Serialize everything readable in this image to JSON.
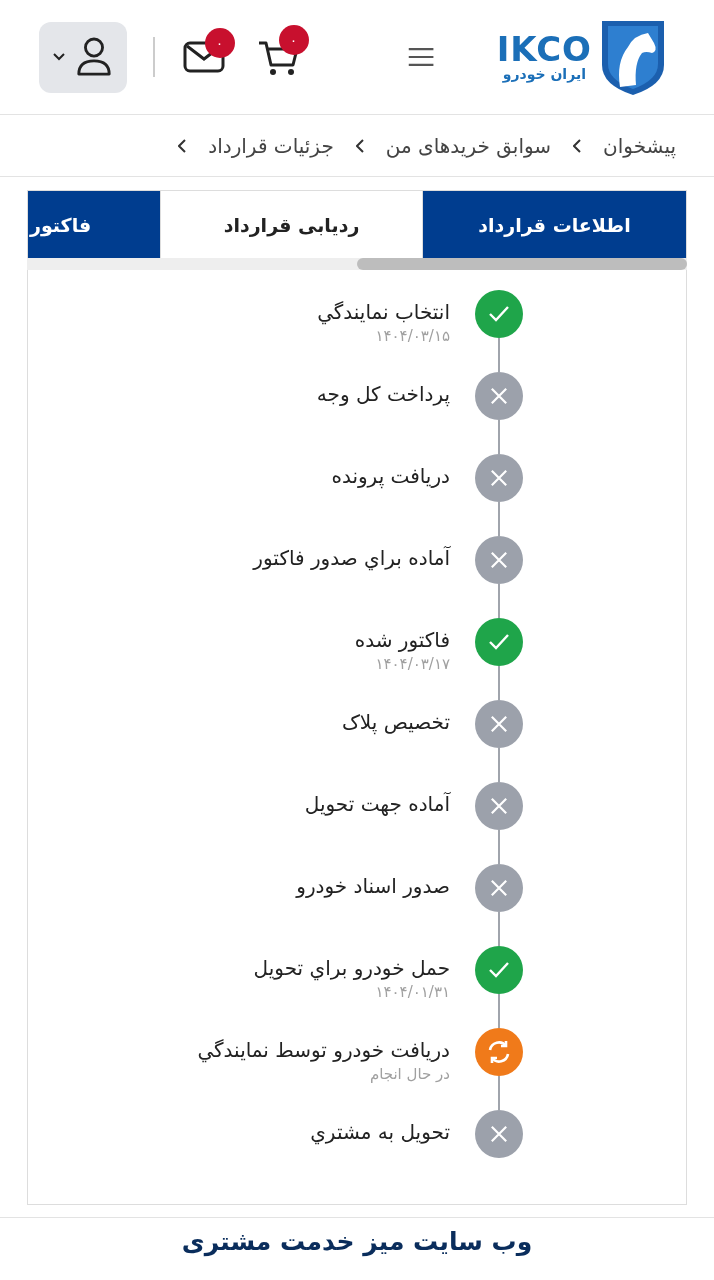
{
  "header": {
    "logo": {
      "latin": "IKCO",
      "persian": "ایران خودرو"
    },
    "cart_badge": "۰",
    "mail_badge": "۰"
  },
  "breadcrumb": [
    "پیشخوان",
    "سوابق خریدهای من",
    "جزئیات قرارداد"
  ],
  "tabs": [
    {
      "label": "اطلاعات قرارداد",
      "selected": false
    },
    {
      "label": "ردیابی قرارداد",
      "selected": true
    },
    {
      "label": "فاکتور",
      "selected": false
    }
  ],
  "steps": [
    {
      "title": "انتخاب نمايندگي",
      "kind": "done",
      "note": "۱۴۰۴/۰۳/۱۵"
    },
    {
      "title": "پرداخت کل وجه",
      "kind": "pending"
    },
    {
      "title": "دریافت پرونده",
      "kind": "pending"
    },
    {
      "title": "آماده براي صدور فاکتور",
      "kind": "pending"
    },
    {
      "title": "فاکتور شده",
      "kind": "done",
      "note": "۱۴۰۴/۰۳/۱۷"
    },
    {
      "title": "تخصیص پلاک",
      "kind": "pending"
    },
    {
      "title": "آماده جهت تحویل",
      "kind": "pending"
    },
    {
      "title": "صدور اسناد خودرو",
      "kind": "pending"
    },
    {
      "title": "حمل خودرو براي تحويل",
      "kind": "done",
      "note": "۱۴۰۴/۰۱/۳۱"
    },
    {
      "title": "دريافت خودرو توسط نمايندگي",
      "kind": "in_progress",
      "note": "در حال انجام"
    },
    {
      "title": "تحويل به مشتري",
      "kind": "pending"
    }
  ],
  "footer": {
    "heading": "وب سایت میز خدمت مشتری"
  }
}
